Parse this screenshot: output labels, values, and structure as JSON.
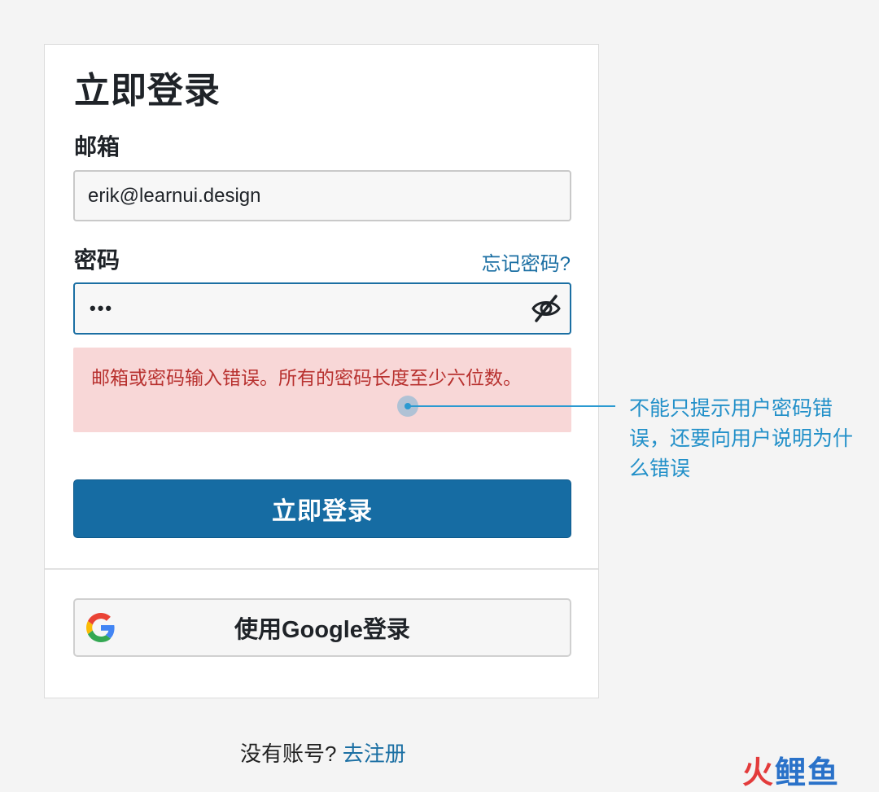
{
  "form": {
    "title": "立即登录",
    "email_label": "邮箱",
    "email_value": "erik@learnui.design",
    "password_label": "密码",
    "forgot_link": "忘记密码?",
    "password_value": "•••",
    "error_message": "邮箱或密码输入错误。所有的密码长度至少六位数。",
    "login_button": "立即登录",
    "google_button": "使用Google登录"
  },
  "signup": {
    "prompt": "没有账号?",
    "link": "去注册"
  },
  "annotation": {
    "text": "不能只提示用户密码错误，还要向用户说明为什么错误"
  },
  "watermark": {
    "char1": "火",
    "char2": "鲤",
    "char3": "鱼"
  },
  "colors": {
    "accent": "#166ca3",
    "error_bg": "#f8d7d7",
    "error_text": "#b8312f",
    "annotation": "#2b9ad1"
  }
}
